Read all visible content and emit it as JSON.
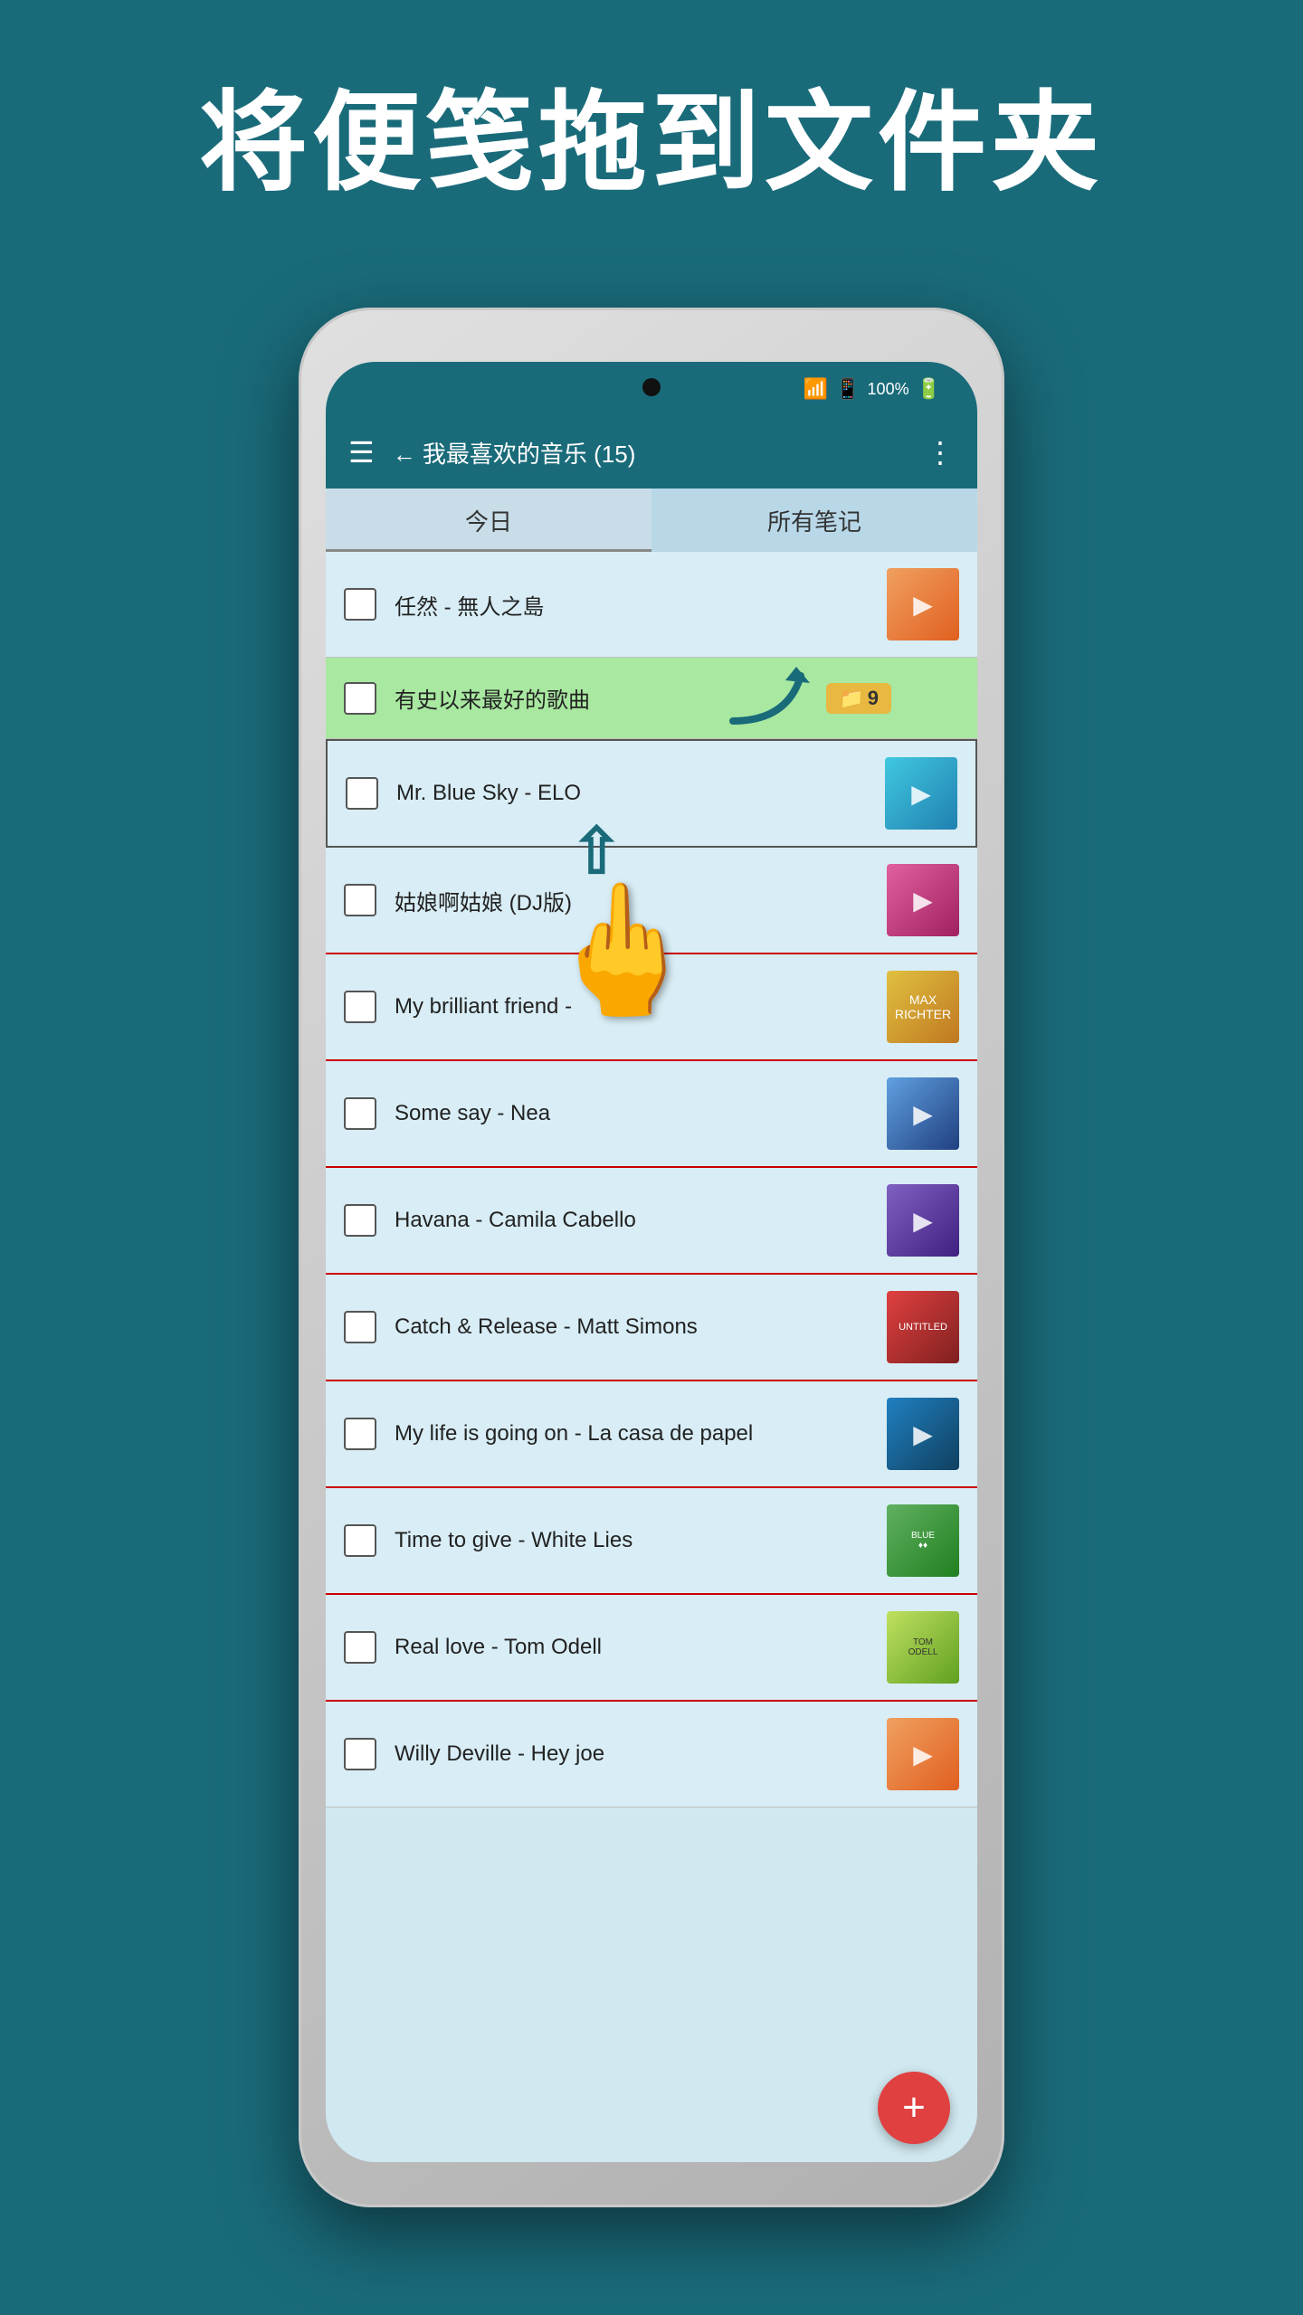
{
  "page": {
    "title": "将便笺拖到文件夹",
    "background_color": "#1a6b7a"
  },
  "phone": {
    "status_bar": {
      "wifi": "WiFi",
      "signal": "Signal",
      "battery": "100%"
    },
    "toolbar": {
      "back_label": "← 我最喜欢的音乐 (15)",
      "tab_today": "今日",
      "tab_all_notes": "所有笔记"
    },
    "items": [
      {
        "id": 1,
        "text": "任然 - 無人之島",
        "thumb_class": "thumb-1",
        "has_play": true
      },
      {
        "id": 2,
        "text": "有史以来最好的歌曲",
        "thumb_class": "thumb-2",
        "highlighted": true,
        "folder_num": "9"
      },
      {
        "id": 3,
        "text": "Mr. Blue Sky - ELO",
        "thumb_class": "thumb-3",
        "selected_border": true
      },
      {
        "id": 4,
        "text": "姑娘啊姑娘 (DJ版)",
        "thumb_class": "thumb-4",
        "has_play": true
      },
      {
        "id": 5,
        "text": "My brilliant friend -",
        "thumb_class": "thumb-5"
      },
      {
        "id": 6,
        "text": "Some say - Nea",
        "thumb_class": "thumb-6",
        "has_play": true
      },
      {
        "id": 7,
        "text": "Havana - Camila Cabello",
        "thumb_class": "thumb-7"
      },
      {
        "id": 8,
        "text": "Catch & Release - Matt Simons",
        "thumb_class": "thumb-8"
      },
      {
        "id": 9,
        "text": "My life is going on - La casa de papel",
        "thumb_class": "thumb-9"
      },
      {
        "id": 10,
        "text": "Time to give - White Lies",
        "thumb_class": "thumb-10"
      },
      {
        "id": 11,
        "text": "Real love - Tom Odell",
        "thumb_class": "thumb-11"
      },
      {
        "id": 12,
        "text": "Willy Deville - Hey joe",
        "thumb_class": "thumb-1"
      }
    ],
    "fab_label": "+"
  }
}
